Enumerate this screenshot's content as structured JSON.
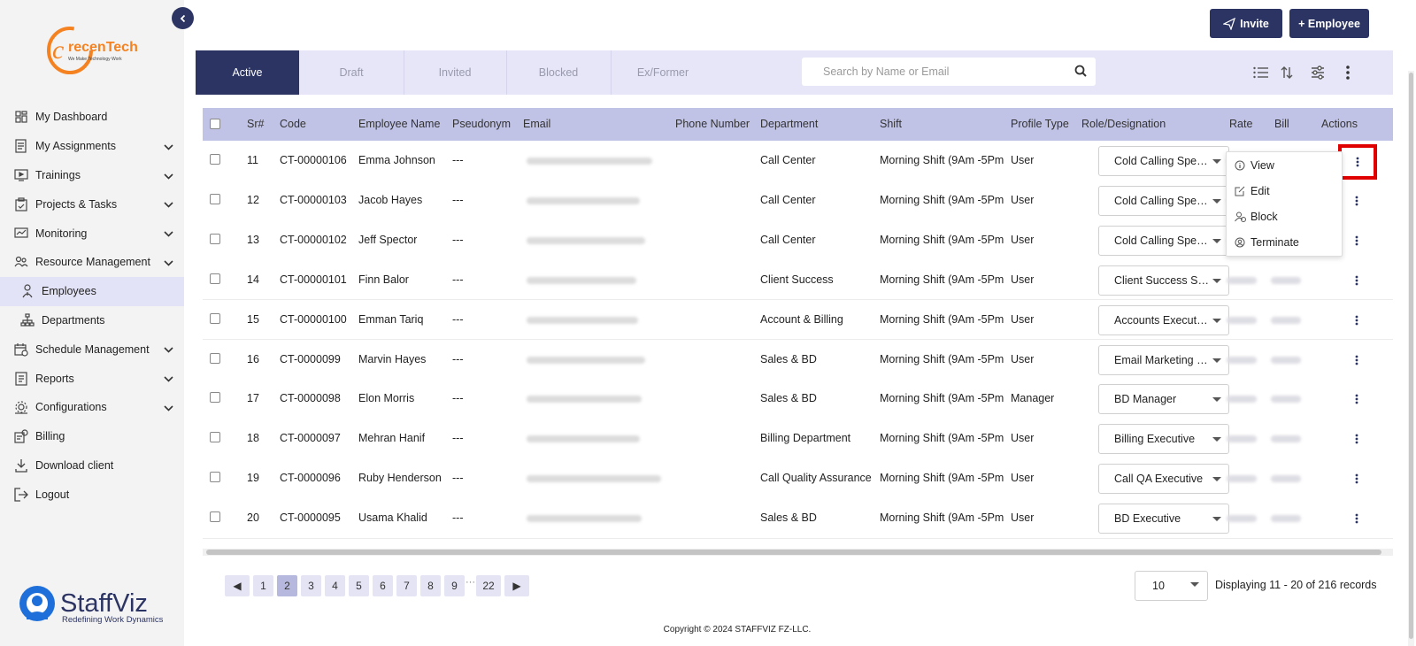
{
  "brand": {
    "top_logo_name": "recenTech",
    "top_logo_tagline": "We Make Technology Work",
    "bottom_logo_name": "StaffViz",
    "bottom_logo_tagline": "Redefining Work Dynamics"
  },
  "sidebar": {
    "items": [
      {
        "label": "My Dashboard",
        "icon": "dashboard-icon",
        "chevron": false
      },
      {
        "label": "My Assignments",
        "icon": "assignments-icon",
        "chevron": true
      },
      {
        "label": "Trainings",
        "icon": "trainings-icon",
        "chevron": true
      },
      {
        "label": "Projects & Tasks",
        "icon": "clipboard-icon",
        "chevron": true
      },
      {
        "label": "Monitoring",
        "icon": "monitoring-icon",
        "chevron": true
      },
      {
        "label": "Resource Management",
        "icon": "users-icon",
        "chevron": true
      },
      {
        "label": "Employees",
        "icon": "employee-icon",
        "chevron": false,
        "active": true
      },
      {
        "label": "Departments",
        "icon": "hierarchy-icon",
        "chevron": false
      },
      {
        "label": "Schedule Management",
        "icon": "schedule-icon",
        "chevron": true
      },
      {
        "label": "Reports",
        "icon": "report-icon",
        "chevron": true
      },
      {
        "label": "Configurations",
        "icon": "config-icon",
        "chevron": true
      },
      {
        "label": "Billing",
        "icon": "billing-icon",
        "chevron": false
      },
      {
        "label": "Download client",
        "icon": "download-icon",
        "chevron": false
      },
      {
        "label": "Logout",
        "icon": "logout-icon",
        "chevron": false
      }
    ]
  },
  "header": {
    "invite_label": "Invite",
    "employee_label": "+ Employee"
  },
  "tabs": [
    "Active",
    "Draft",
    "Invited",
    "Blocked",
    "Ex/Former"
  ],
  "search": {
    "placeholder": "Search by Name or Email",
    "value": ""
  },
  "table": {
    "columns": [
      "Sr#",
      "Code",
      "Employee Name",
      "Pseudonym",
      "Email",
      "Phone Number",
      "Department",
      "Shift",
      "Profile Type",
      "Role/Designation",
      "Rate",
      "Bill",
      "Actions"
    ],
    "rows": [
      {
        "sr": "11",
        "code": "CT-00000106",
        "name": "Emma Johnson",
        "pseudonym": "---",
        "department": "Call Center",
        "shift": "Morning Shift (9Am -5Pm",
        "profile": "User",
        "role": "Cold Calling Speci..."
      },
      {
        "sr": "12",
        "code": "CT-00000103",
        "name": "Jacob Hayes",
        "pseudonym": "---",
        "department": "Call Center",
        "shift": "Morning Shift (9Am -5Pm",
        "profile": "User",
        "role": "Cold Calling Speci..."
      },
      {
        "sr": "13",
        "code": "CT-00000102",
        "name": "Jeff Spector",
        "pseudonym": "---",
        "department": "Call Center",
        "shift": "Morning Shift (9Am -5Pm",
        "profile": "User",
        "role": "Cold Calling Speci..."
      },
      {
        "sr": "14",
        "code": "CT-00000101",
        "name": "Finn Balor",
        "pseudonym": "---",
        "department": "Client Success",
        "shift": "Morning Shift (9Am -5Pm",
        "profile": "User",
        "role": "Client Success Sp..."
      },
      {
        "sr": "15",
        "code": "CT-00000100",
        "name": "Emman Tariq",
        "pseudonym": "---",
        "department": "Account & Billing",
        "shift": "Morning Shift (9Am -5Pm",
        "profile": "User",
        "role": "Accounts Executive"
      },
      {
        "sr": "16",
        "code": "CT-0000099",
        "name": "Marvin Hayes",
        "pseudonym": "---",
        "department": "Sales & BD",
        "shift": "Morning Shift (9Am -5Pm",
        "profile": "User",
        "role": "Email Marketing E..."
      },
      {
        "sr": "17",
        "code": "CT-0000098",
        "name": "Elon Morris",
        "pseudonym": "---",
        "department": "Sales & BD",
        "shift": "Morning Shift (9Am -5Pm",
        "profile": "Manager",
        "role": "BD Manager"
      },
      {
        "sr": "18",
        "code": "CT-0000097",
        "name": "Mehran Hanif",
        "pseudonym": "---",
        "department": "Billing Department",
        "shift": "Morning Shift (9Am -5Pm",
        "profile": "User",
        "role": "Billing Executive"
      },
      {
        "sr": "19",
        "code": "CT-0000096",
        "name": "Ruby Henderson",
        "pseudonym": "---",
        "department": "Call Quality Assurance",
        "shift": "Morning Shift (9Am -5Pm",
        "profile": "User",
        "role": "Call QA Executive"
      },
      {
        "sr": "20",
        "code": "CT-0000095",
        "name": "Usama Khalid",
        "pseudonym": "---",
        "department": "Sales & BD",
        "shift": "Morning Shift (9Am -5Pm",
        "profile": "User",
        "role": "BD Executive"
      }
    ]
  },
  "context_menu": {
    "items": [
      {
        "label": "View",
        "icon": "info-icon"
      },
      {
        "label": "Edit",
        "icon": "edit-icon"
      },
      {
        "label": "Block",
        "icon": "block-user-icon"
      },
      {
        "label": "Terminate",
        "icon": "terminate-icon"
      }
    ]
  },
  "pagination": {
    "prev": "◀",
    "next": "▶",
    "pages": [
      "1",
      "2",
      "3",
      "4",
      "5",
      "6",
      "7",
      "8",
      "9",
      "22"
    ],
    "current": "2",
    "ellipsis": "···",
    "per_page": "10",
    "display_text": "Displaying 11 - 20 of 216 records"
  },
  "footer": {
    "copyright": "Copyright © 2024 STAFFVIZ FZ-LLC."
  },
  "colors": {
    "primary": "#2c3463",
    "tab_bg": "#e6e6f8",
    "header_bg": "#c0c3e6",
    "highlight": "#e00000",
    "logo_orange": "#f58220",
    "logo_blue": "#1e6fd9"
  }
}
